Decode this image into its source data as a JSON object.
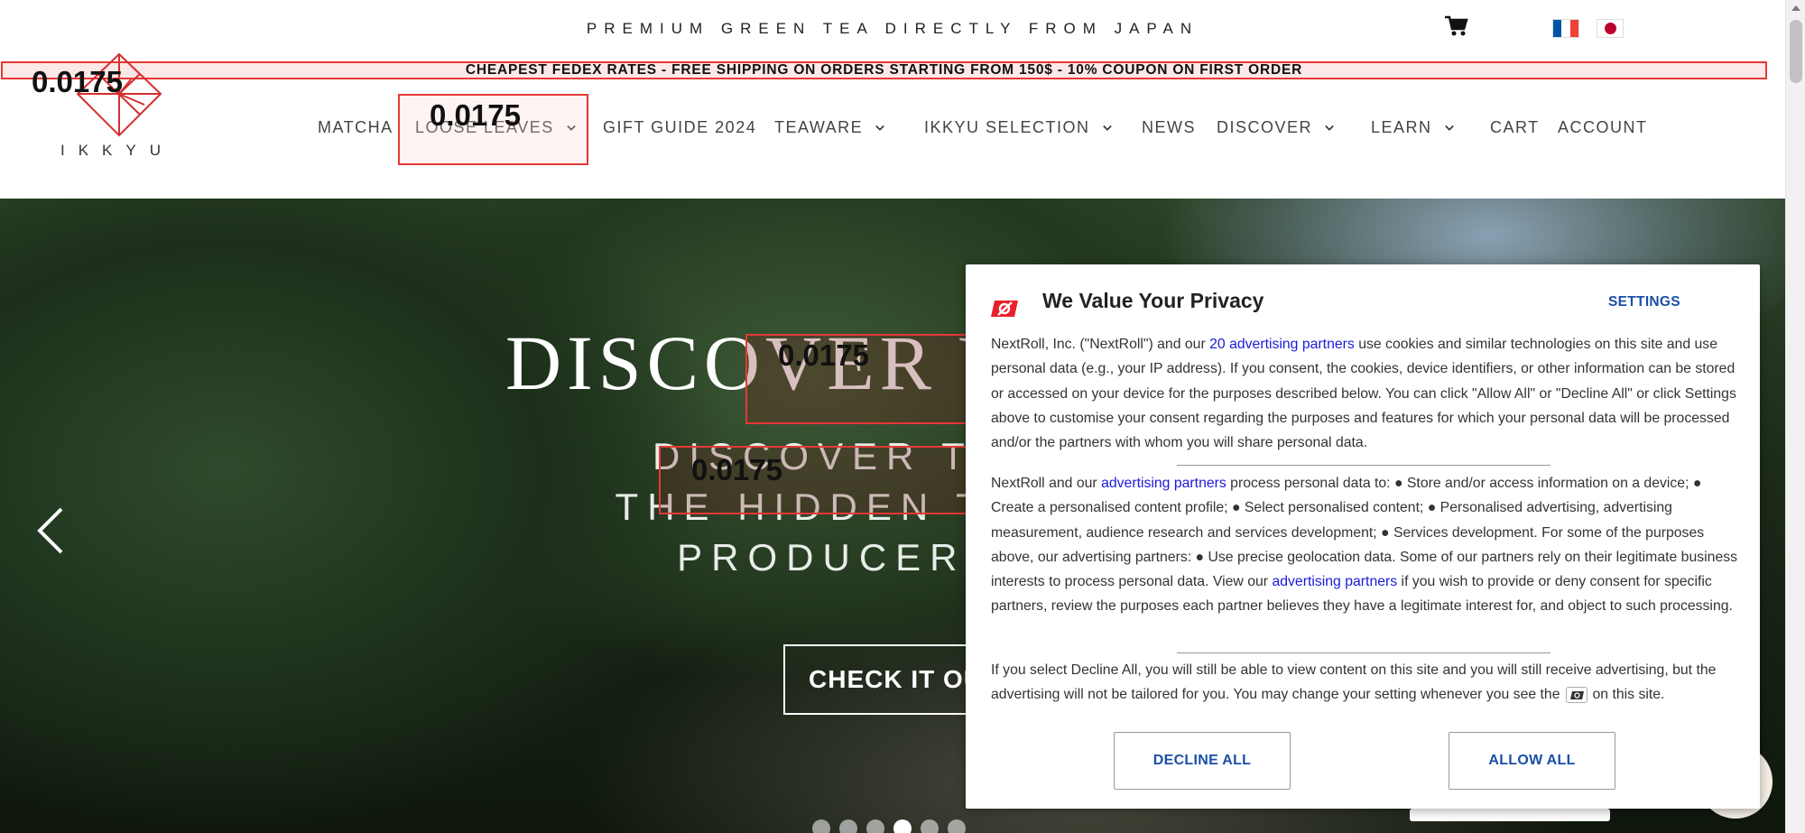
{
  "topbar": {
    "tagline": "PREMIUM GREEN TEA DIRECTLY FROM JAPAN",
    "cart_icon": "cart-icon",
    "flags": [
      "flag-france-icon",
      "flag-japan-icon"
    ]
  },
  "announcement": "CHEAPEST FEDEX RATES - FREE SHIPPING ON ORDERS STARTING FROM 150$ - 10% COUPON ON FIRST ORDER",
  "logo": {
    "text": "IKKYU"
  },
  "nav": {
    "items": [
      {
        "label": "MATCHA",
        "dropdown": false
      },
      {
        "label": "LOOSE LEAVES",
        "dropdown": true
      },
      {
        "label": "GIFT GUIDE 2024",
        "dropdown": false
      },
      {
        "label": "TEAWARE",
        "dropdown": true
      },
      {
        "label": "IKKYU SELECTION",
        "dropdown": true
      },
      {
        "label": "NEWS",
        "dropdown": false
      },
      {
        "label": "DISCOVER",
        "dropdown": true
      },
      {
        "label": "LEARN",
        "dropdown": true
      },
      {
        "label": "CART",
        "dropdown": false
      },
      {
        "label": "ACCOUNT",
        "dropdown": false
      }
    ]
  },
  "overlay_labels": [
    "0.0175",
    "0.0175",
    "0.0175",
    "0.0175"
  ],
  "hero": {
    "title": "DISCOVER YA",
    "subtitle_lines": [
      "DISCOVER THE SE",
      "THE HIDDEN TEA VAL",
      "PRODUCER INTE"
    ],
    "button": "CHECK IT OU",
    "slide_count": 6,
    "active_slide": 4
  },
  "privacy_modal": {
    "title": "We Value Your Privacy",
    "settings_label": "SETTINGS",
    "p1_before": "NextRoll, Inc. (\"NextRoll\") and our ",
    "p1_link": "20 advertising partners",
    "p1_after": " use cookies and similar technologies on this site and use personal data (e.g., your IP address). If you consent, the cookies, device identifiers, or other information can be stored or accessed on your device for the purposes described below. You can click \"Allow All\" or \"Decline All\" or click Settings above to customise your consent regarding the purposes and features for which your personal data will be processed and/or the partners with whom you will share personal data.",
    "p2_before": "NextRoll and our ",
    "p2_link1": "advertising partners",
    "p2_middle": " process personal data to: ● Store and/or access information on a device; ● Create a personalised content profile; ● Select personalised content; ● Personalised advertising, advertising measurement, audience research and services development; ● Services development. For some of the purposes above, our advertising partners: ● Use precise geolocation data. Some of our partners rely on their legitimate business interests to process personal data. View our ",
    "p2_link2": "advertising partners",
    "p2_after": " if you wish to provide or deny consent for specific partners, review the purposes each partner believes they have a legitimate interest for, and object to such processing.",
    "p3_before": "If you select Decline All, you will still be able to view content on this site and you will still receive advertising, but the advertising will not be tailored for you. You may change your setting whenever you see the",
    "p3_after": "on this site.",
    "decline_label": "DECLINE ALL",
    "allow_label": "ALLOW ALL"
  },
  "colors": {
    "accent_red": "#e53935",
    "link_blue": "#1a1adb",
    "button_blue": "#1a4fa8",
    "logo_red": "#d32f2f"
  }
}
